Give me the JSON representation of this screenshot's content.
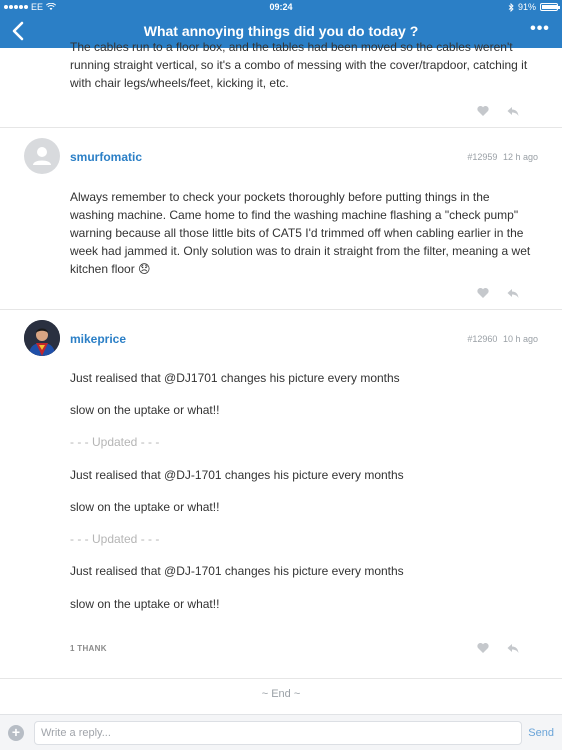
{
  "status_bar": {
    "carrier": "EE",
    "time": "09:24",
    "battery": "91%",
    "battery_level": 0.91
  },
  "nav": {
    "title": "What annoying things did you do today ?"
  },
  "post0": {
    "text_lines": [
      "The cables run to a floor box, and the tables had been moved so the cables weren't",
      "running straight vertical, so it's a combo of messing with the cover/trapdoor, catching it",
      "with chair legs/wheels/feet, kicking it, etc."
    ]
  },
  "post1": {
    "author": "smurfomatic",
    "id": "#12959",
    "time": "12 h ago",
    "text_lines": [
      "Always remember to check your pockets thoroughly before putting things in the",
      "washing machine. Came home to find the washing machine flashing a \"check pump\"",
      "warning because all those little bits of CAT5 I'd trimmed off when cabling earlier in the",
      "week had jammed it. Only solution was to drain it straight from the filter, meaning a wet",
      "kitchen floor 😞"
    ]
  },
  "post2": {
    "author": "mikeprice",
    "id": "#12960",
    "time": "10 h ago",
    "lines": [
      "Just realised that  @DJ1701 changes his picture every months",
      "slow on the uptake or what!!",
      "- - - Updated - - -",
      "Just realised that  @DJ-1701 changes his picture every months",
      "slow on the uptake or what!!",
      "- - - Updated - - -",
      "Just realised that  @DJ-1701 changes his picture every months",
      "slow on the uptake or what!!"
    ],
    "thanks": "1 THANK"
  },
  "end_label": "~ End ~",
  "reply": {
    "placeholder": "Write a reply...",
    "send_label": "Send"
  },
  "colors": {
    "brand": "#2b7fc6",
    "author": "#2b7fc6",
    "muted_text": "#b5b5b5"
  },
  "icons": {
    "back": "chevron-left-icon",
    "more": "ellipsis-icon",
    "like": "heart-icon",
    "reply": "reply-arrow-icon",
    "add": "plus-icon"
  }
}
